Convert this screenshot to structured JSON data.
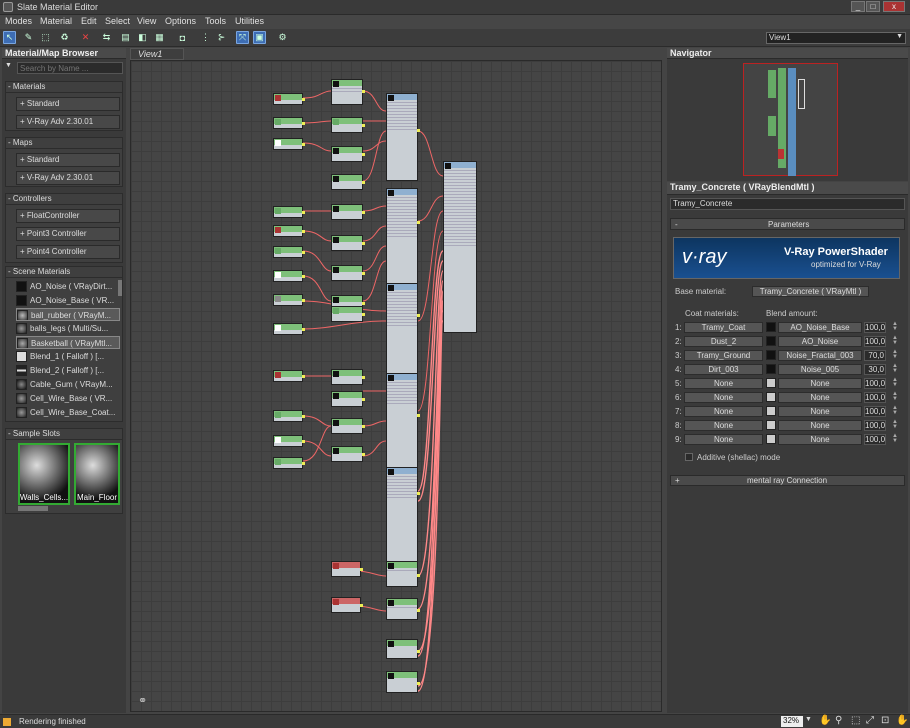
{
  "window": {
    "title": "Slate Material Editor",
    "min": "_",
    "max": "□",
    "close": "x"
  },
  "menu": [
    "Modes",
    "Material",
    "Edit",
    "Select",
    "View",
    "Options",
    "Tools",
    "Utilities"
  ],
  "view_select": {
    "value": "View1"
  },
  "browser": {
    "title": "Material/Map Browser",
    "search_placeholder": "Search by Name ...",
    "groups": [
      {
        "label": "- Materials",
        "items": [
          "+ Standard",
          "+ V-Ray Adv 2.30.01"
        ]
      },
      {
        "label": "- Maps",
        "items": [
          "+ Standard",
          "+ V-Ray Adv 2.30.01"
        ]
      },
      {
        "label": "- Controllers",
        "items": [
          "+ FloatController",
          "+ Point3 Controller",
          "+ Point4 Controller"
        ]
      }
    ],
    "scene": {
      "label": "- Scene Materials",
      "items": [
        "AO_Noise ( VRayDirt...",
        "AO_Noise_Base ( VR...",
        "ball_rubber ( VRayM...",
        "balls_legs ( Multi/Su...",
        "Basketball ( VRayMtl...",
        "Blend_1 ( Falloff ) [...",
        "Blend_2 ( Falloff ) [...",
        "Cable_Gum ( VRayM...",
        "Cell_Wire_Base ( VR...",
        "Cell_Wire_Base_Coat..."
      ]
    },
    "samples": {
      "label": "- Sample Slots",
      "items": [
        "Walls_Cells...",
        "Main_Floor"
      ]
    }
  },
  "view_tab": "View1",
  "navigator": {
    "title": "Navigator"
  },
  "material": {
    "header": "Tramy_Concrete  ( VRayBlendMtl )",
    "name": "Tramy_Concrete",
    "rollout": "Parameters",
    "banner_logo": "v·ray",
    "banner_title": "V-Ray PowerShader",
    "banner_sub": "optimized for V-Ray",
    "base_label": "Base material:",
    "base_value": "Tramy_Concrete  ( VRayMtl )",
    "coat_label": "Coat materials:",
    "blend_label": "Blend amount:",
    "rows": [
      {
        "i": "1:",
        "coat": "Tramy_Coat",
        "blend": "AO_Noise_Base",
        "amt": "100,0"
      },
      {
        "i": "2:",
        "coat": "Dust_2",
        "blend": "AO_Noise",
        "amt": "100,0"
      },
      {
        "i": "3:",
        "coat": "Tramy_Ground",
        "blend": "Noise_Fractal_003",
        "amt": "70,0"
      },
      {
        "i": "4:",
        "coat": "Dirt_003",
        "blend": "Noise_005",
        "amt": "30,0"
      },
      {
        "i": "5:",
        "coat": "None",
        "blend": "None",
        "amt": "100,0"
      },
      {
        "i": "6:",
        "coat": "None",
        "blend": "None",
        "amt": "100,0"
      },
      {
        "i": "7:",
        "coat": "None",
        "blend": "None",
        "amt": "100,0"
      },
      {
        "i": "8:",
        "coat": "None",
        "blend": "None",
        "amt": "100,0"
      },
      {
        "i": "9:",
        "coat": "None",
        "blend": "None",
        "amt": "100,0"
      }
    ],
    "additive_label": "Additive (shellac) mode",
    "mr_rollout": "mental ray Connection",
    "mr_sign": "+",
    "params_sign": "-"
  },
  "status": {
    "text": "Rendering finished",
    "zoom": "32%"
  }
}
